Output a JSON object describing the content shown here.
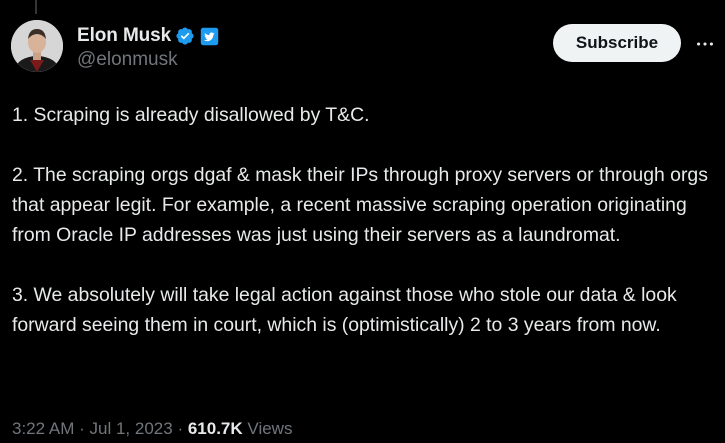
{
  "author": {
    "display_name": "Elon Musk",
    "handle": "@elonmusk",
    "verified_badge": "verified-check-icon",
    "affiliate_badge": "twitter-bird-icon"
  },
  "actions": {
    "subscribe_label": "Subscribe",
    "more_icon": "more-horizontal-icon"
  },
  "tweet": {
    "paragraphs": [
      "1. Scraping is already disallowed by T&C.",
      "2. The scraping orgs dgaf & mask their IPs through proxy servers or through orgs that appear legit. For example, a recent massive scraping operation originating from Oracle IP addresses was just using their servers as a laundromat.",
      "3. We absolutely will take legal action against those who stole our data & look forward seeing them in court, which is (optimistically) 2 to 3 years from now."
    ]
  },
  "meta": {
    "time": "3:22 AM",
    "separator": "·",
    "date": "Jul 1, 2023",
    "views_count": "610.7K",
    "views_label": "Views"
  },
  "colors": {
    "background": "#000000",
    "text_primary": "#e7e9ea",
    "text_secondary": "#71767b",
    "verified_blue": "#1d9bf0",
    "button_bg": "#eff3f4",
    "button_text": "#0f1419"
  }
}
